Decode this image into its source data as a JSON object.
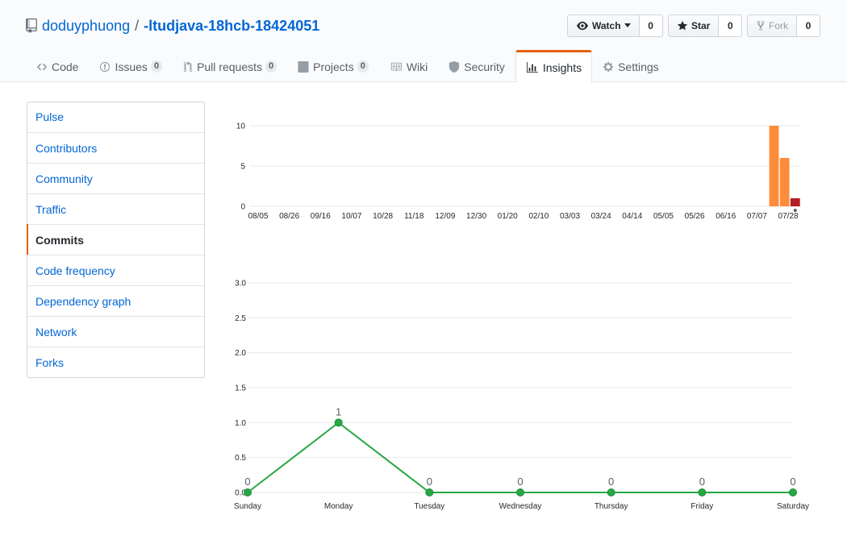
{
  "repo": {
    "owner": "doduyphuong",
    "separator": "/",
    "name": "-ltudjava-18hcb-18424051"
  },
  "actions": {
    "watch": {
      "label": "Watch",
      "count": "0"
    },
    "star": {
      "label": "Star",
      "count": "0"
    },
    "fork": {
      "label": "Fork",
      "count": "0"
    }
  },
  "tabs": [
    {
      "label": "Code",
      "count": "",
      "icon": "code-icon"
    },
    {
      "label": "Issues",
      "count": "0",
      "icon": "issue-icon"
    },
    {
      "label": "Pull requests",
      "count": "0",
      "icon": "pull-request-icon"
    },
    {
      "label": "Projects",
      "count": "0",
      "icon": "project-icon"
    },
    {
      "label": "Wiki",
      "count": "",
      "icon": "book-icon"
    },
    {
      "label": "Security",
      "count": "",
      "icon": "shield-icon"
    },
    {
      "label": "Insights",
      "count": "",
      "icon": "graph-icon",
      "selected": true
    },
    {
      "label": "Settings",
      "count": "",
      "icon": "gear-icon"
    }
  ],
  "sidebar": {
    "items": [
      {
        "label": "Pulse"
      },
      {
        "label": "Contributors"
      },
      {
        "label": "Community"
      },
      {
        "label": "Traffic"
      },
      {
        "label": "Commits",
        "active": true
      },
      {
        "label": "Code frequency"
      },
      {
        "label": "Dependency graph"
      },
      {
        "label": "Network"
      },
      {
        "label": "Forks"
      }
    ]
  },
  "colors": {
    "link": "#0366d6",
    "accent": "#e36209",
    "bar": "#fd8c3a",
    "bar_selected": "#b31d28",
    "line": "#28a745"
  },
  "chart_data": [
    {
      "type": "bar",
      "ylim": [
        0,
        10
      ],
      "yticks": [
        0,
        5,
        10
      ],
      "xtick_labels": [
        "08/05",
        "08/26",
        "09/16",
        "10/07",
        "10/28",
        "11/18",
        "12/09",
        "12/30",
        "01/20",
        "02/10",
        "03/03",
        "03/24",
        "04/14",
        "05/05",
        "05/26",
        "06/16",
        "07/07",
        "07/28"
      ],
      "weeks": 52,
      "values": [
        0,
        0,
        0,
        0,
        0,
        0,
        0,
        0,
        0,
        0,
        0,
        0,
        0,
        0,
        0,
        0,
        0,
        0,
        0,
        0,
        0,
        0,
        0,
        0,
        0,
        0,
        0,
        0,
        0,
        0,
        0,
        0,
        0,
        0,
        0,
        0,
        0,
        0,
        0,
        0,
        0,
        0,
        0,
        0,
        0,
        0,
        0,
        0,
        0,
        10,
        6,
        1
      ],
      "selected_index": 51
    },
    {
      "type": "line",
      "categories": [
        "Sunday",
        "Monday",
        "Tuesday",
        "Wednesday",
        "Thursday",
        "Friday",
        "Saturday"
      ],
      "values": [
        0,
        1,
        0,
        0,
        0,
        0,
        0
      ],
      "value_labels": [
        "0",
        "1",
        "0",
        "0",
        "0",
        "0",
        "0"
      ],
      "ylim": [
        0,
        3.0
      ],
      "yticks": [
        "0.0",
        "0.5",
        "1.0",
        "1.5",
        "2.0",
        "2.5",
        "3.0"
      ]
    }
  ]
}
